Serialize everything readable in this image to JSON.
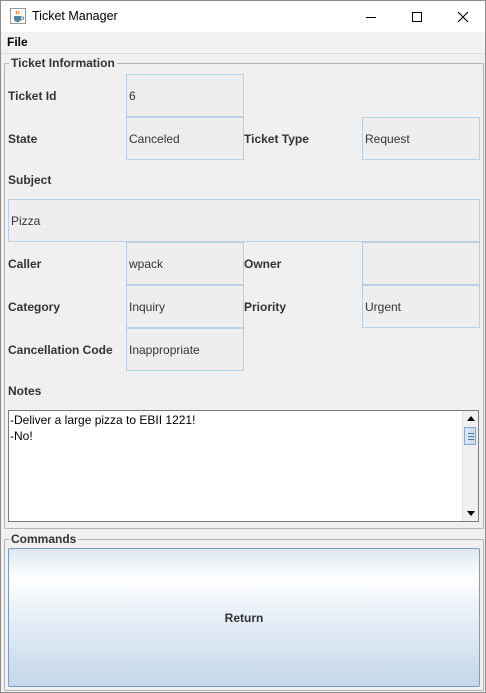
{
  "window": {
    "title": "Ticket Manager"
  },
  "menu": {
    "file": "File"
  },
  "ticket_info": {
    "legend": "Ticket Information",
    "ticket_id_label": "Ticket Id",
    "ticket_id": "6",
    "state_label": "State",
    "state": "Canceled",
    "ticket_type_label": "Ticket Type",
    "ticket_type": "Request",
    "subject_label": "Subject",
    "subject": "Pizza",
    "caller_label": "Caller",
    "caller": "wpack",
    "owner_label": "Owner",
    "owner": "",
    "category_label": "Category",
    "category": "Inquiry",
    "priority_label": "Priority",
    "priority": "Urgent",
    "cancellation_label": "Cancellation Code",
    "cancellation": "Inappropriate",
    "notes_label": "Notes",
    "notes": "-Deliver a large pizza to EBII 1221!\n-No!"
  },
  "commands": {
    "legend": "Commands",
    "return_label": "Return"
  },
  "icons": {
    "app": "java-cup-icon",
    "minimize": "minimize-icon",
    "maximize": "maximize-icon",
    "close": "close-icon"
  }
}
